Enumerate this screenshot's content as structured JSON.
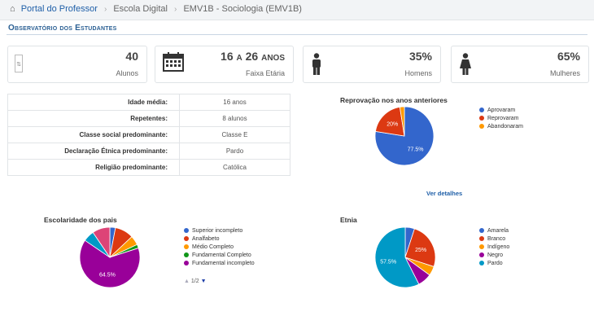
{
  "breadcrumb": {
    "home": "Portal do Professor",
    "items": [
      "Escola Digital",
      "EMV1B - Sociologia (EMV1B)"
    ]
  },
  "page_title": "Observatório dos Estudantes",
  "cards": [
    {
      "icon": "sort-icon",
      "value": "40",
      "label": "Alunos"
    },
    {
      "icon": "calendar-icon",
      "value_a": "16",
      "value_b": "a",
      "value_c": "26",
      "value_d": "anos",
      "label": "Faixa Etária"
    },
    {
      "icon": "male-icon",
      "value": "35%",
      "label": "Homens"
    },
    {
      "icon": "female-icon",
      "value": "65%",
      "label": "Mulheres"
    }
  ],
  "info_table": [
    {
      "key": "Idade média:",
      "value": "16 anos"
    },
    {
      "key": "Repetentes:",
      "value": "8 alunos"
    },
    {
      "key": "Classe social predominante:",
      "value": "Classe E"
    },
    {
      "key": "Declaração Étnica predominante:",
      "value": "Pardo"
    },
    {
      "key": "Religião predominante:",
      "value": "Católica"
    }
  ],
  "more_link": "Ver detalhes",
  "pager": {
    "text": "1/2"
  },
  "colors": {
    "blue": "#3366cc",
    "red": "#dc3912",
    "orange": "#ff9900",
    "green": "#109618",
    "purple": "#990099",
    "teal": "#0099c6",
    "pink": "#dd4477"
  },
  "chart_data": [
    {
      "type": "pie",
      "title": "Reprovação nos anos anteriores",
      "labels": [
        "Aprovaram",
        "Reprovaram",
        "Abandonaram"
      ],
      "values": [
        77.5,
        20,
        2.5
      ],
      "slice_labels": [
        "77.5%",
        "20%",
        ""
      ],
      "colors": [
        "#3366cc",
        "#dc3912",
        "#ff9900"
      ]
    },
    {
      "type": "pie",
      "title": "Escolaridade dos pais",
      "labels": [
        "Superior incompleto",
        "Analfabeto",
        "Médio Completo",
        "Fundamental Completo",
        "Fundamental incompleto"
      ],
      "extra_slices": [
        {
          "color": "#0099c6"
        },
        {
          "color": "#dd4477"
        }
      ],
      "values": [
        3,
        10,
        5,
        2,
        64.5,
        6,
        9.5
      ],
      "slice_labels": [
        "",
        "",
        "",
        "",
        "64.5%",
        "",
        ""
      ],
      "colors": [
        "#3366cc",
        "#dc3912",
        "#ff9900",
        "#109618",
        "#990099",
        "#0099c6",
        "#dd4477"
      ]
    },
    {
      "type": "pie",
      "title": "Etnia",
      "labels": [
        "Amarela",
        "Branco",
        "Indígeno",
        "Negro",
        "Pardo"
      ],
      "values": [
        5,
        25,
        5,
        7.5,
        57.5
      ],
      "slice_labels": [
        "",
        "25%",
        "",
        "",
        "57.5%"
      ],
      "colors": [
        "#3366cc",
        "#dc3912",
        "#ff9900",
        "#990099",
        "#0099c6"
      ]
    }
  ]
}
